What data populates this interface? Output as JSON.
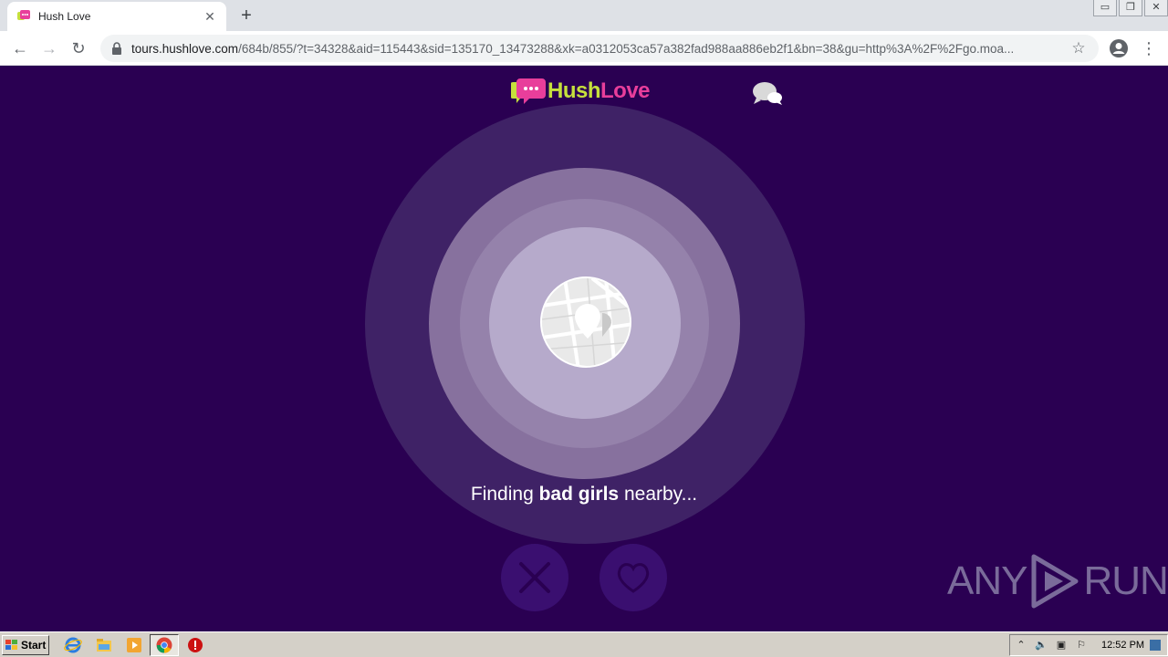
{
  "browser": {
    "tab_title": "Hush Love",
    "tab_close": "✕",
    "new_tab": "+",
    "url_host": "tours.hushlove.com",
    "url_path": "/684b/855/?t=34328&aid=115443&sid=135170_13473288&xk=a0312053ca57a382fad988aa886eb2f1&bn=38&gu=http%3A%2F%2Fgo.moa...",
    "back": "←",
    "forward": "→",
    "reload": "↻",
    "star": "☆",
    "menu": "⋮",
    "window_controls": [
      "▭",
      "❐",
      "✕"
    ]
  },
  "page": {
    "logo_hush": "Hush",
    "logo_love": "Love",
    "finding_prefix": "Finding ",
    "finding_bold": "bad girls",
    "finding_suffix": " nearby...",
    "watermark_left": "ANY",
    "watermark_right": "RUN"
  },
  "taskbar": {
    "start_label": "Start",
    "clock": "12:52 PM"
  },
  "colors": {
    "page_bg": "#2a0052",
    "logo_hush": "#c6e03c",
    "logo_love": "#e83e9b"
  }
}
